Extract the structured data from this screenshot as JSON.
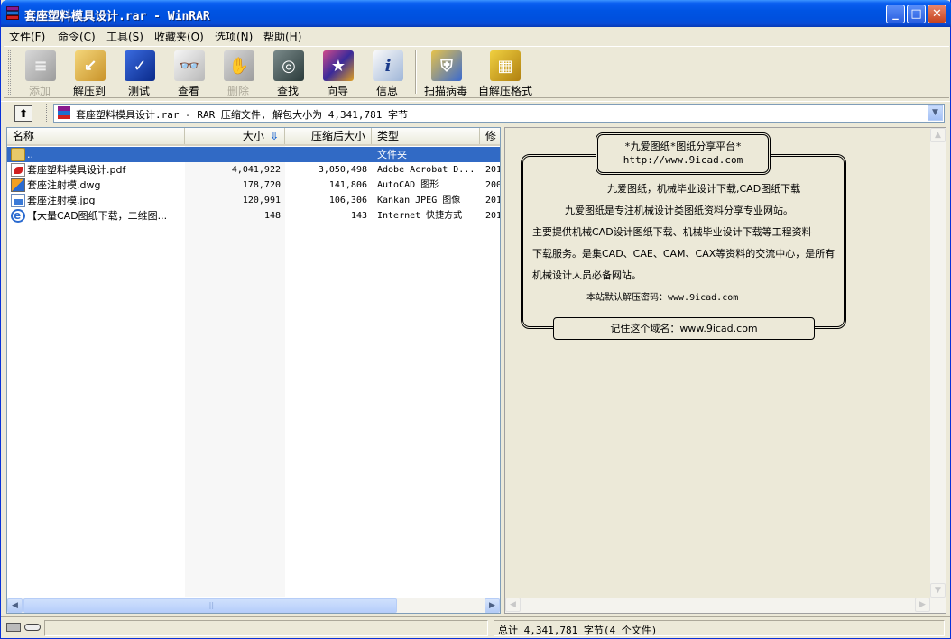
{
  "window": {
    "title": "套座塑料模具设计.rar - WinRAR"
  },
  "menu": [
    {
      "label": "文件(F)"
    },
    {
      "label": "命令(C)"
    },
    {
      "label": "工具(S)"
    },
    {
      "label": "收藏夹(O)"
    },
    {
      "label": "选项(N)"
    },
    {
      "label": "帮助(H)"
    }
  ],
  "toolbar": [
    {
      "label": "添加",
      "icon": "add-icon",
      "enabled": false
    },
    {
      "label": "解压到",
      "icon": "extract-to-icon",
      "enabled": true
    },
    {
      "label": "测试",
      "icon": "test-icon",
      "enabled": true
    },
    {
      "label": "查看",
      "icon": "view-icon",
      "enabled": true
    },
    {
      "label": "删除",
      "icon": "delete-icon",
      "enabled": false
    },
    {
      "label": "查找",
      "icon": "find-icon",
      "enabled": true
    },
    {
      "label": "向导",
      "icon": "wizard-icon",
      "enabled": true
    },
    {
      "label": "信息",
      "icon": "info-icon",
      "enabled": true
    },
    {
      "label": "扫描病毒",
      "icon": "virus-scan-icon",
      "enabled": true
    },
    {
      "label": "自解压格式",
      "icon": "sfx-icon",
      "enabled": true
    }
  ],
  "address": {
    "text": "套座塑料模具设计.rar - RAR 压缩文件, 解包大小为 4,341,781 字节"
  },
  "columns": {
    "name": "名称",
    "size": "大小",
    "packed": "压缩后大小",
    "type": "类型",
    "modified": "修"
  },
  "files": [
    {
      "name": "..",
      "size": "",
      "packed": "",
      "type": "文件夹",
      "modified": "",
      "icon": "folder-icon",
      "selected": true
    },
    {
      "name": "套座塑料模具设计.pdf",
      "size": "4,041,922",
      "packed": "3,050,498",
      "type": "Adobe Acrobat D...",
      "modified": "201",
      "icon": "pdf-icon",
      "selected": false
    },
    {
      "name": "套座注射模.dwg",
      "size": "178,720",
      "packed": "141,806",
      "type": "AutoCAD 图形",
      "modified": "200",
      "icon": "dwg-icon",
      "selected": false
    },
    {
      "name": "套座注射模.jpg",
      "size": "120,991",
      "packed": "106,306",
      "type": "Kankan JPEG 图像",
      "modified": "201",
      "icon": "jpg-icon",
      "selected": false
    },
    {
      "name": "【大量CAD图纸下载，二维图...",
      "size": "148",
      "packed": "143",
      "type": "Internet 快捷方式",
      "modified": "201",
      "icon": "internet-shortcut-icon",
      "selected": false
    }
  ],
  "comment": {
    "header_line1": "*九爱图纸*图纸分享平台*",
    "header_line2": "http://www.9icad.com",
    "line1": "九爱图纸，机械毕业设计下载,CAD图纸下载",
    "line2": "九爱图纸是专注机械设计类图纸资料分享专业网站。",
    "line3": "主要提供机械CAD设计图纸下载、机械毕业设计下载等工程资料",
    "line4": "下载服务。是集CAD、CAE、CAM、CAX等资料的交流中心，是所有",
    "line5": "机械设计人员必备网站。",
    "line6": "本站默认解压密码：www.9icad.com",
    "footer": "记住这个域名：www.9icad.com"
  },
  "status": {
    "left": "",
    "right": "总计 4,341,781 字节(4 个文件)"
  }
}
